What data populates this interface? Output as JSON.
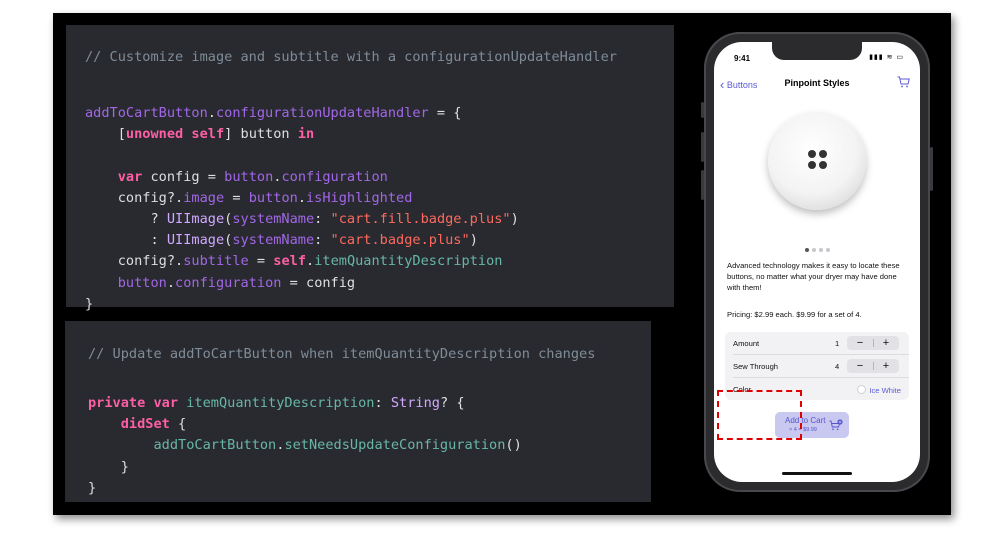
{
  "code_block_1": {
    "comment": "// Customize image and subtitle with a configurationUpdateHandler",
    "lines": [
      [
        [
          "p",
          "addToCartButton"
        ],
        [
          "w",
          "."
        ],
        [
          "m",
          "configurationUpdateHandler"
        ],
        [
          "w",
          " = {"
        ]
      ],
      [
        [
          "w",
          "    ["
        ],
        [
          "k",
          "unowned self"
        ],
        [
          "w",
          "] button "
        ],
        [
          "k",
          "in"
        ]
      ],
      [],
      [
        [
          "w",
          "    "
        ],
        [
          "k",
          "var"
        ],
        [
          "w",
          " config = "
        ],
        [
          "m",
          "button"
        ],
        [
          "w",
          "."
        ],
        [
          "m",
          "configuration"
        ]
      ],
      [
        [
          "w",
          "    config?."
        ],
        [
          "m",
          "image"
        ],
        [
          "w",
          " = "
        ],
        [
          "m",
          "button"
        ],
        [
          "w",
          "."
        ],
        [
          "m",
          "isHighlighted"
        ]
      ],
      [
        [
          "w",
          "        ? "
        ],
        [
          "t",
          "UIImage"
        ],
        [
          "w",
          "("
        ],
        [
          "m",
          "systemName"
        ],
        [
          "w",
          ": "
        ],
        [
          "s",
          "\"cart.fill.badge.plus\""
        ],
        [
          "w",
          ")"
        ]
      ],
      [
        [
          "w",
          "        : "
        ],
        [
          "t",
          "UIImage"
        ],
        [
          "w",
          "("
        ],
        [
          "m",
          "systemName"
        ],
        [
          "w",
          ": "
        ],
        [
          "s",
          "\"cart.badge.plus\""
        ],
        [
          "w",
          ")"
        ]
      ],
      [
        [
          "w",
          "    config?."
        ],
        [
          "m",
          "subtitle"
        ],
        [
          "w",
          " = "
        ],
        [
          "k",
          "self"
        ],
        [
          "w",
          "."
        ],
        [
          "c",
          "itemQuantityDescription"
        ]
      ],
      [
        [
          "w",
          "    "
        ],
        [
          "m",
          "button"
        ],
        [
          "w",
          "."
        ],
        [
          "m",
          "configuration"
        ],
        [
          "w",
          " = config"
        ]
      ],
      [
        [
          "w",
          "}"
        ]
      ]
    ]
  },
  "code_block_2": {
    "comment": "// Update addToCartButton when itemQuantityDescription changes",
    "lines": [
      [
        [
          "k",
          "private var"
        ],
        [
          "w",
          " "
        ],
        [
          "c",
          "itemQuantityDescription"
        ],
        [
          "w",
          ": "
        ],
        [
          "t",
          "String"
        ],
        [
          "w",
          "? {"
        ]
      ],
      [
        [
          "w",
          "    "
        ],
        [
          "k",
          "didSet"
        ],
        [
          "w",
          " {"
        ]
      ],
      [
        [
          "w",
          "        "
        ],
        [
          "c",
          "addToCartButton"
        ],
        [
          "w",
          "."
        ],
        [
          "c",
          "setNeedsUpdateConfiguration"
        ],
        [
          "w",
          "()"
        ]
      ],
      [
        [
          "w",
          "    }"
        ]
      ],
      [
        [
          "w",
          "}"
        ]
      ]
    ]
  },
  "phone": {
    "status_time": "9:41",
    "status_icons": "▮▮▮ ≋ ▭",
    "nav": {
      "back_label": "Buttons",
      "title": "Pinpoint Styles",
      "cart_icon": "cart-icon"
    },
    "page_count": 4,
    "active_page": 1,
    "description": "Advanced technology makes it easy to locate these buttons, no matter what your dryer may have done with them!",
    "pricing": "Pricing: $2.99 each. $9.99 for a set of 4.",
    "options": {
      "amount_label": "Amount",
      "amount_value": "1",
      "sew_label": "Sew Through",
      "sew_value": "4",
      "color_label": "Color",
      "color_value": "Ice White",
      "minus_glyph": "−",
      "plus_glyph": "+"
    },
    "cart_button": {
      "title": "Add to Cart",
      "subtitle": "× 4 = $9.99",
      "icon": "cart-badge-plus-icon"
    }
  },
  "colors": {
    "code_bg": "#292a30",
    "keyword": "#fc5fa3",
    "property": "#a167e6",
    "string": "#fc6a5d",
    "method": "#67b7a4",
    "accent": "#5b5bd6",
    "highlight": "#e10000"
  }
}
